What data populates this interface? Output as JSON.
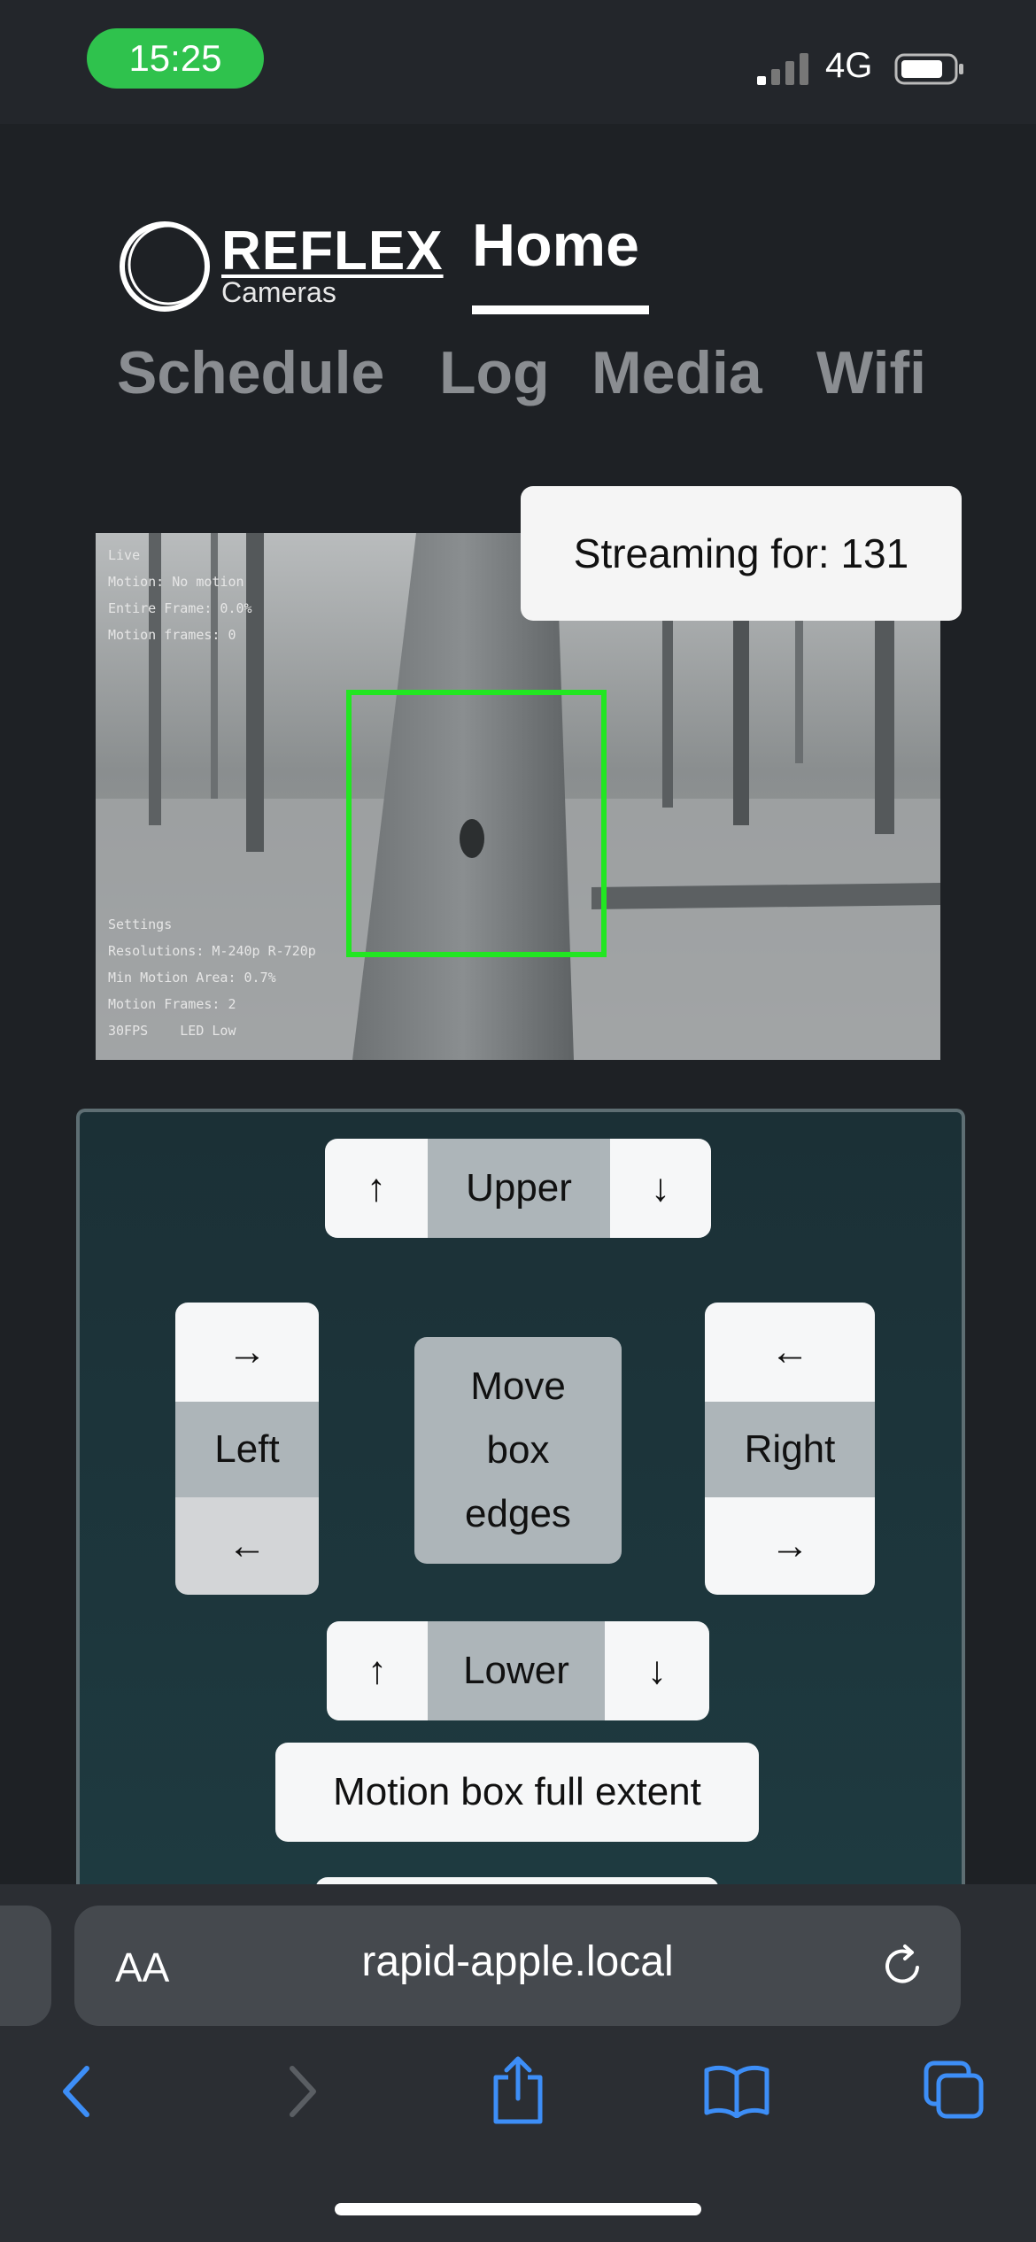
{
  "status": {
    "time": "15:25",
    "network": "4G"
  },
  "brand": {
    "name": "REFLEX",
    "sub": "Cameras"
  },
  "nav": {
    "active": "Home",
    "items": [
      "Schedule",
      "Log",
      "Media",
      "Wifi"
    ]
  },
  "stream": {
    "label": "Streaming for: 131",
    "overlay_top": [
      "Live",
      "Motion: No motion",
      "Entire Frame: 0.0%",
      "Motion frames: 0"
    ],
    "overlay_bottom": [
      "Settings",
      "Resolutions: M-240p R-720p",
      "Min Motion Area: 0.7%",
      "Motion Frames: 2",
      "30FPS    LED Low"
    ]
  },
  "controls": {
    "upper": {
      "label": "Upper",
      "up": "↑",
      "down": "↓"
    },
    "lower": {
      "label": "Lower",
      "up": "↑",
      "down": "↓"
    },
    "left": {
      "label": "Left",
      "top": "→",
      "bottom": "←"
    },
    "right": {
      "label": "Right",
      "top": "←",
      "bottom": "→"
    },
    "center": {
      "line1": "Move",
      "line2": "box",
      "line3": "edges"
    },
    "full_extent": "Motion box full extent"
  },
  "browser": {
    "aa": "AA",
    "url": "rapid-apple.local"
  },
  "colors": {
    "accent_blue": "#3d8ef7",
    "status_green": "#2fc24d",
    "motion_box": "#22e622"
  }
}
